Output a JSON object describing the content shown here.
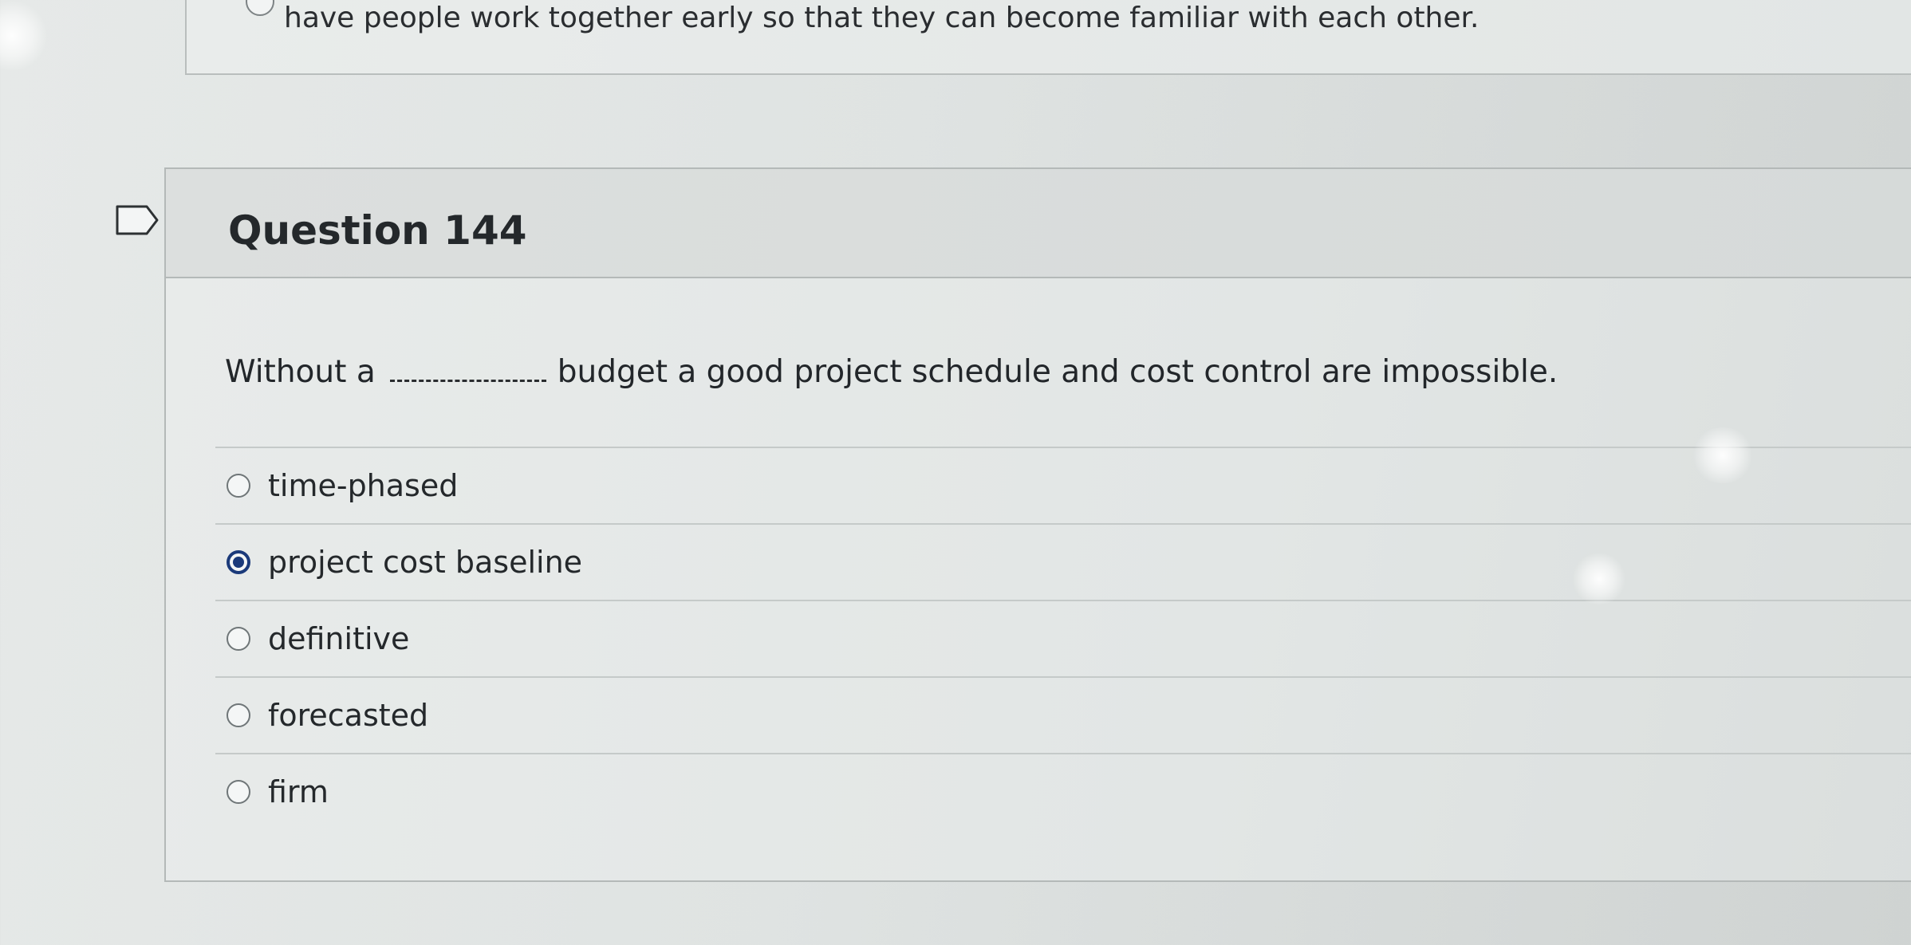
{
  "previous_question": {
    "answer_text": "have people work together early so that they can become familiar with each other."
  },
  "question": {
    "title": "Question 144",
    "text_before_blank": "Without a",
    "text_after_blank": "budget a good project schedule and cost control are impossible.",
    "answers": [
      {
        "label": "time-phased",
        "selected": false
      },
      {
        "label": "project cost baseline",
        "selected": true
      },
      {
        "label": "definitive",
        "selected": false
      },
      {
        "label": "forecasted",
        "selected": false
      },
      {
        "label": "firm",
        "selected": false
      }
    ]
  },
  "colors": {
    "selected_radio": "#1b3a7a",
    "background": "#e2e6e5"
  },
  "icons": {
    "flag": "flag-icon"
  }
}
